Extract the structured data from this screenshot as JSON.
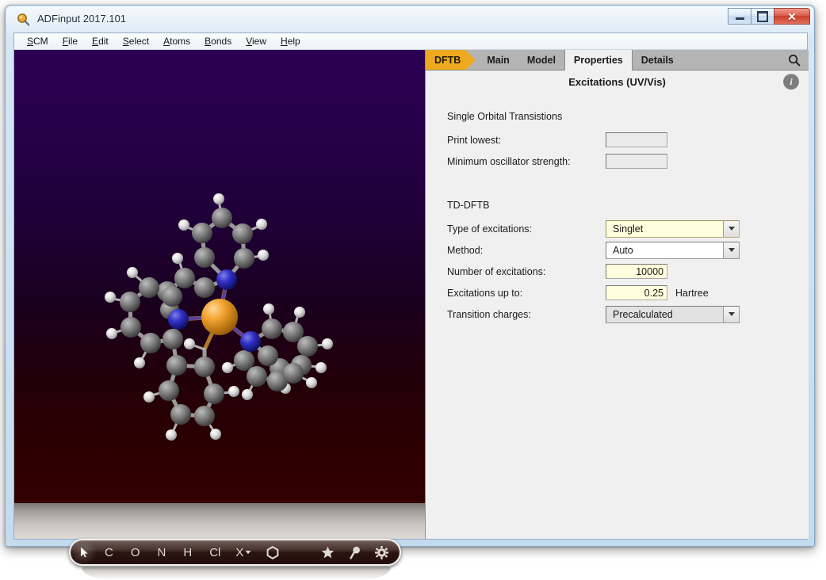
{
  "window": {
    "title": "ADFinput 2017.101",
    "icon": "magnifier-icon",
    "buttons": {
      "minimize": "minimize-icon",
      "maximize": "maximize-icon",
      "close": "✕"
    }
  },
  "menubar": {
    "items": [
      {
        "mnemonic": "S",
        "rest": "CM"
      },
      {
        "mnemonic": "F",
        "rest": "ile"
      },
      {
        "mnemonic": "E",
        "rest": "dit"
      },
      {
        "mnemonic": "S",
        "rest": "elect"
      },
      {
        "mnemonic": "A",
        "rest": "toms"
      },
      {
        "mnemonic": "B",
        "rest": "onds"
      },
      {
        "mnemonic": "V",
        "rest": "iew"
      },
      {
        "mnemonic": "H",
        "rest": "elp"
      }
    ]
  },
  "tabs": {
    "items": [
      {
        "label": "DFTB",
        "accent": true,
        "active": false
      },
      {
        "label": "Main",
        "accent": false,
        "active": false
      },
      {
        "label": "Model",
        "accent": false,
        "active": false
      },
      {
        "label": "Properties",
        "accent": false,
        "active": true
      },
      {
        "label": "Details",
        "accent": false,
        "active": false
      }
    ],
    "search_icon": "search-icon",
    "accent_color": "#eda920",
    "strip_color": "#b4b4b4"
  },
  "panel": {
    "title": "Excitations (UV/Vis)",
    "info_label": "i",
    "groups": [
      {
        "heading": "Single Orbital Transistions",
        "rows": [
          {
            "label": "Print lowest:",
            "type": "field",
            "value": "",
            "modified": false
          },
          {
            "label": "Minimum oscillator strength:",
            "type": "field",
            "value": "",
            "modified": false
          }
        ]
      },
      {
        "heading": "TD-DFTB",
        "rows": [
          {
            "label": "Type of excitations:",
            "type": "combo",
            "value": "Singlet",
            "modified": true,
            "disabled": false
          },
          {
            "label": "Method:",
            "type": "combo",
            "value": "Auto",
            "modified": false,
            "disabled": false
          },
          {
            "label": "Number of excitations:",
            "type": "field",
            "value": "10000",
            "modified": true
          },
          {
            "label": "Excitations up to:",
            "type": "field",
            "value": "0.25",
            "modified": true,
            "unit": "Hartree"
          },
          {
            "label": "Transition charges:",
            "type": "combo",
            "value": "Precalculated",
            "modified": false,
            "disabled": true
          }
        ]
      }
    ]
  },
  "viewport": {
    "background_top": "#2b0052",
    "background_bottom": "#330000",
    "floor_color": "#dedbd8",
    "molecule": {
      "description": "octahedral metal tris-bipyridine complex",
      "atom_colors": {
        "metal": "#f0a030",
        "carbon": "#787878",
        "nitrogen": "#2828c8",
        "hydrogen": "#e8e8e8"
      }
    }
  },
  "element_toolbar": {
    "items": [
      {
        "label": "",
        "icon": "cursor-arrow-icon",
        "selected": true
      },
      {
        "label": "C",
        "icon": "",
        "selected": false
      },
      {
        "label": "O",
        "icon": "",
        "selected": false
      },
      {
        "label": "N",
        "icon": "",
        "selected": false
      },
      {
        "label": "H",
        "icon": "",
        "selected": false
      },
      {
        "label": "Cl",
        "icon": "",
        "selected": false
      },
      {
        "label": "X",
        "icon": "chevron-down-icon",
        "selected": false
      },
      {
        "label": "",
        "icon": "hexagon-ring-icon",
        "selected": false
      },
      {
        "label": "",
        "icon": "star-icon",
        "selected": false
      },
      {
        "label": "",
        "icon": "pin-tool-icon",
        "selected": false
      },
      {
        "label": "",
        "icon": "gear-icon",
        "selected": false
      }
    ]
  }
}
